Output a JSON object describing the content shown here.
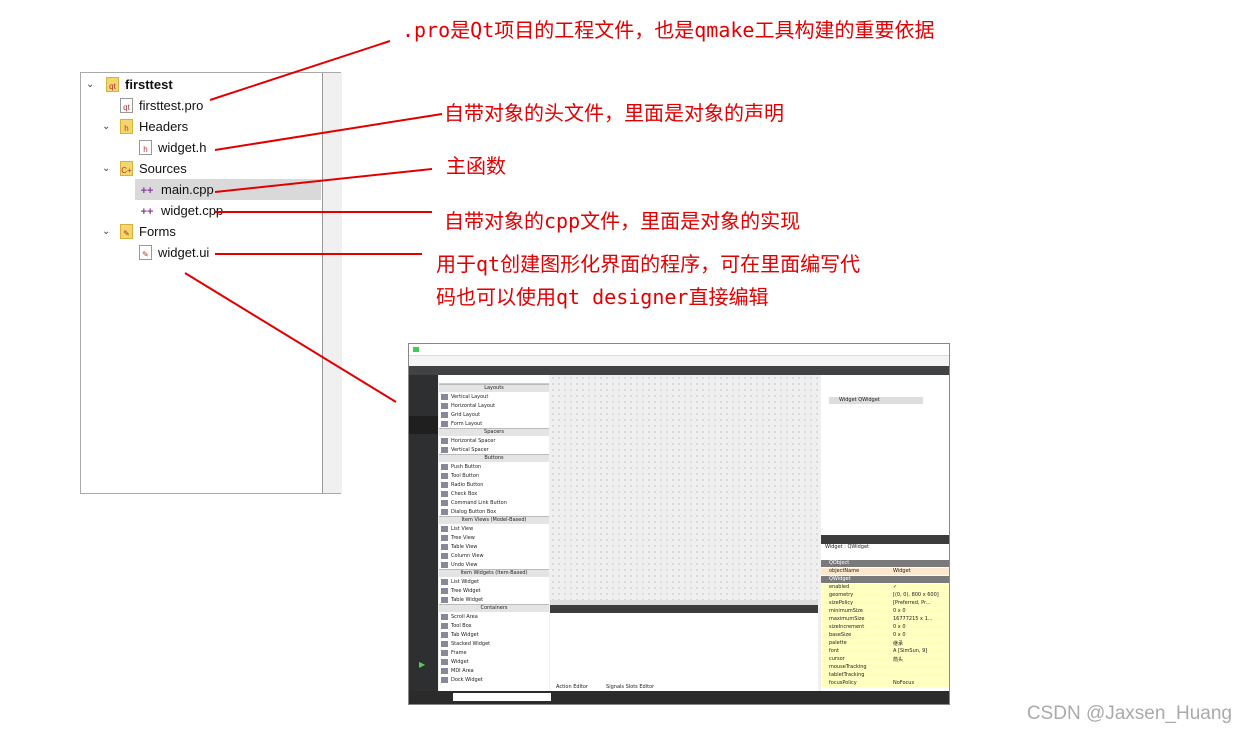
{
  "project_tree": {
    "items": [
      {
        "label": "firsttest",
        "icon": "qt-project-folder-icon",
        "expanded": true,
        "bold": true
      },
      {
        "label": "firsttest.pro",
        "icon": "qt-pro-file-icon"
      },
      {
        "label": "Headers",
        "icon": "headers-folder-icon",
        "expanded": true
      },
      {
        "label": "widget.h",
        "icon": "header-file-icon"
      },
      {
        "label": "Sources",
        "icon": "sources-folder-icon",
        "expanded": true
      },
      {
        "label": "main.cpp",
        "icon": "cpp-file-icon",
        "selected": true
      },
      {
        "label": "widget.cpp",
        "icon": "cpp-file-icon"
      },
      {
        "label": "Forms",
        "icon": "forms-folder-icon",
        "expanded": true
      },
      {
        "label": "widget.ui",
        "icon": "ui-file-icon"
      }
    ]
  },
  "annotations": {
    "pro": ".pro是Qt项目的工程文件，也是qmake工具构建的重要依据",
    "header": "自带对象的头文件，里面是对象的声明",
    "main": "主函数",
    "cpp": "自带对象的cpp文件，里面是对象的实现",
    "ui_line1": "用于qt创建图形化界面的程序，可在里面编写代",
    "ui_line2": "码也可以使用qt designer直接编辑",
    "color": "#e00000"
  },
  "designer": {
    "object_tree": {
      "item": "Widget QWidget"
    },
    "widget_box": [
      {
        "category": "Layouts",
        "items": [
          "Vertical Layout",
          "Horizontal Layout",
          "Grid Layout",
          "Form Layout"
        ]
      },
      {
        "category": "Spacers",
        "items": [
          "Horizontal Spacer",
          "Vertical Spacer"
        ]
      },
      {
        "category": "Buttons",
        "items": [
          "Push Button",
          "Tool Button",
          "Radio Button",
          "Check Box",
          "Command Link Button",
          "Dialog Button Box"
        ]
      },
      {
        "category": "Item Views (Model-Based)",
        "items": [
          "List View",
          "Tree View",
          "Table View",
          "Column View",
          "Undo View"
        ]
      },
      {
        "category": "Item Widgets (Item-Based)",
        "items": [
          "List Widget",
          "Tree Widget",
          "Table Widget"
        ]
      },
      {
        "category": "Containers",
        "items": [
          "Scroll Area",
          "Tool Box",
          "Tab Widget",
          "Stacked Widget",
          "Frame",
          "Widget",
          "MDI Area",
          "Dock Widget"
        ]
      }
    ],
    "properties": {
      "header": "Widget : QWidget",
      "rows": [
        {
          "name": "QObject",
          "value": "",
          "group": true
        },
        {
          "name": "objectName",
          "value": "Widget"
        },
        {
          "name": "QWidget",
          "value": "",
          "group": true
        },
        {
          "name": "enabled",
          "value": "✓"
        },
        {
          "name": "geometry",
          "value": "[(0, 0), 800 x 600]"
        },
        {
          "name": "sizePolicy",
          "value": "[Preferred, Pr..."
        },
        {
          "name": "minimumSize",
          "value": "0 x 0"
        },
        {
          "name": "maximumSize",
          "value": "16777215 x 1..."
        },
        {
          "name": "sizeIncrement",
          "value": "0 x 0"
        },
        {
          "name": "baseSize",
          "value": "0 x 0"
        },
        {
          "name": "palette",
          "value": "继承"
        },
        {
          "name": "font",
          "value": "A [SimSun, 9]"
        },
        {
          "name": "cursor",
          "value": "箭头"
        },
        {
          "name": "mouseTracking",
          "value": ""
        },
        {
          "name": "tabletTracking",
          "value": ""
        },
        {
          "name": "focusPolicy",
          "value": "NoFocus"
        }
      ]
    },
    "tabs": [
      "Action Editor",
      "Signals Slots Editor"
    ]
  },
  "watermark": "CSDN @Jaxsen_Huang"
}
